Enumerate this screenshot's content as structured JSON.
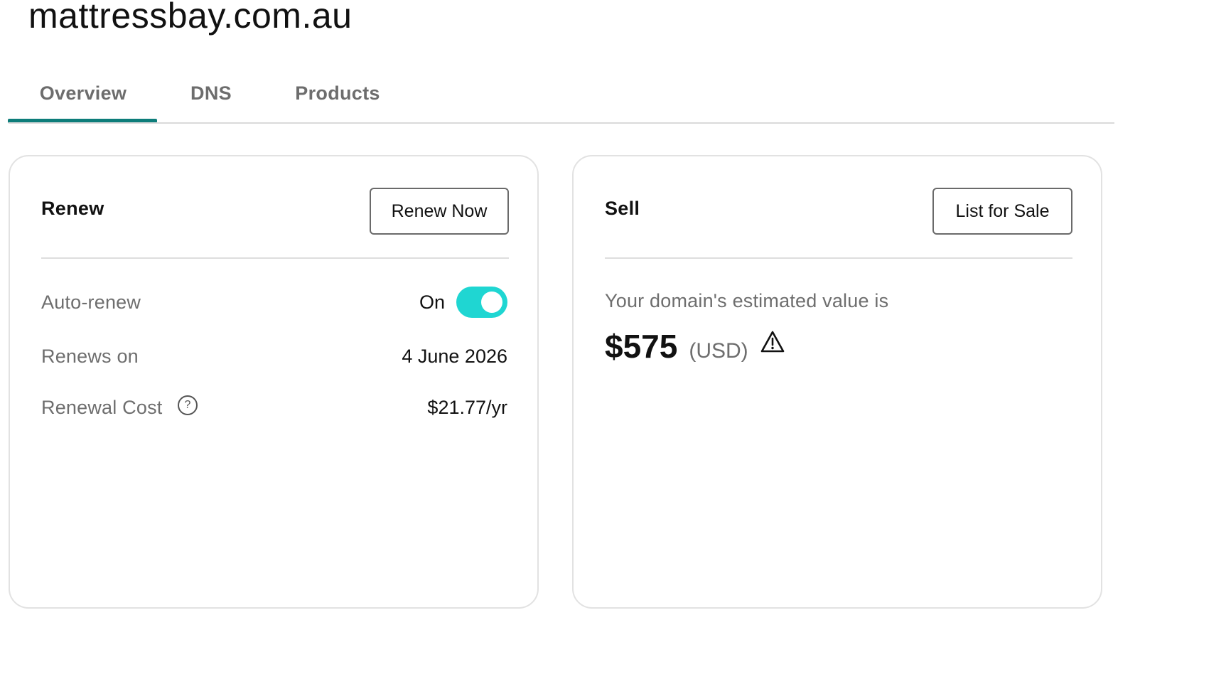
{
  "domain": {
    "name": "mattressbay.com.au"
  },
  "tabs": [
    {
      "label": "Overview",
      "active": true
    },
    {
      "label": "DNS",
      "active": false
    },
    {
      "label": "Products",
      "active": false
    }
  ],
  "renew_card": {
    "title": "Renew",
    "button_label": "Renew Now",
    "auto_renew": {
      "label": "Auto-renew",
      "state_label": "On",
      "enabled": true
    },
    "renews_on": {
      "label": "Renews on",
      "value": "4 June 2026"
    },
    "renewal_cost": {
      "label": "Renewal Cost",
      "value": "$21.77/yr",
      "help_icon": "question-circle-icon",
      "help_glyph": "?"
    }
  },
  "sell_card": {
    "title": "Sell",
    "button_label": "List for Sale",
    "description": "Your domain's estimated value is",
    "value": "$575",
    "currency": "(USD)",
    "warning_icon": "warning-triangle-icon"
  },
  "colors": {
    "accent_teal": "#0d7d7a",
    "toggle_on": "#1fd6d2",
    "text_muted": "#6e6e6e",
    "border": "#e2e2e2"
  }
}
